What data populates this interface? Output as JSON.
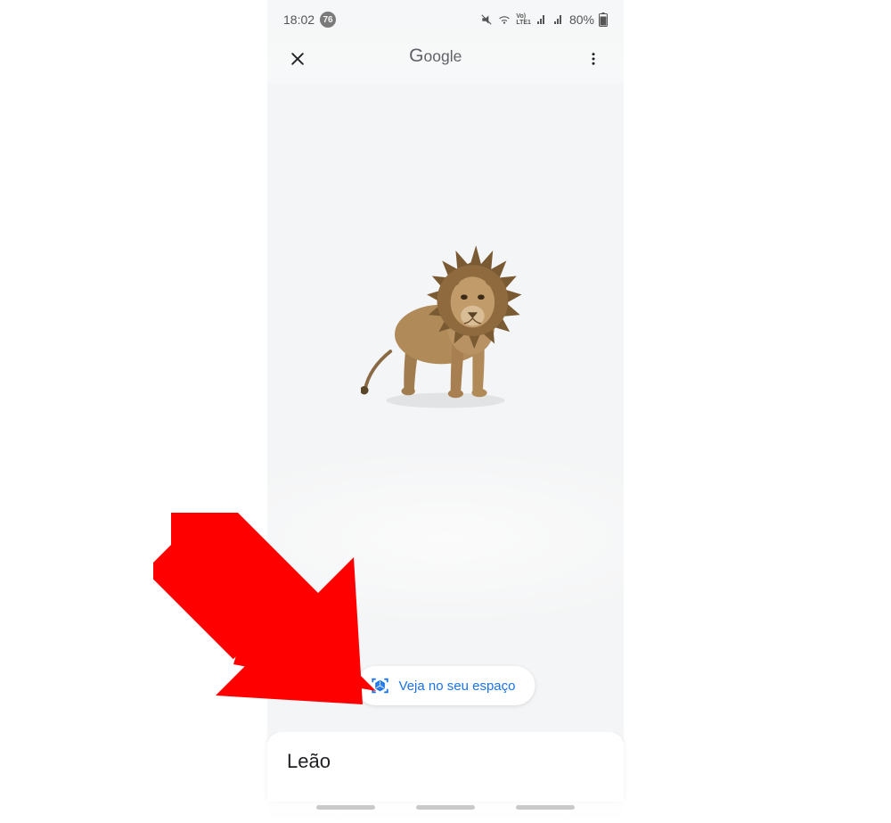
{
  "status_bar": {
    "time": "18:02",
    "notification_count": "76",
    "battery_percent": "80%"
  },
  "app_bar": {
    "title": "Google"
  },
  "viewer": {
    "subject": "lion-3d-model"
  },
  "ar_button": {
    "label": "Veja no seu espaço"
  },
  "sheet": {
    "title": "Leão"
  },
  "colors": {
    "accent": "#1a73e8",
    "annotation": "#ff0000"
  }
}
